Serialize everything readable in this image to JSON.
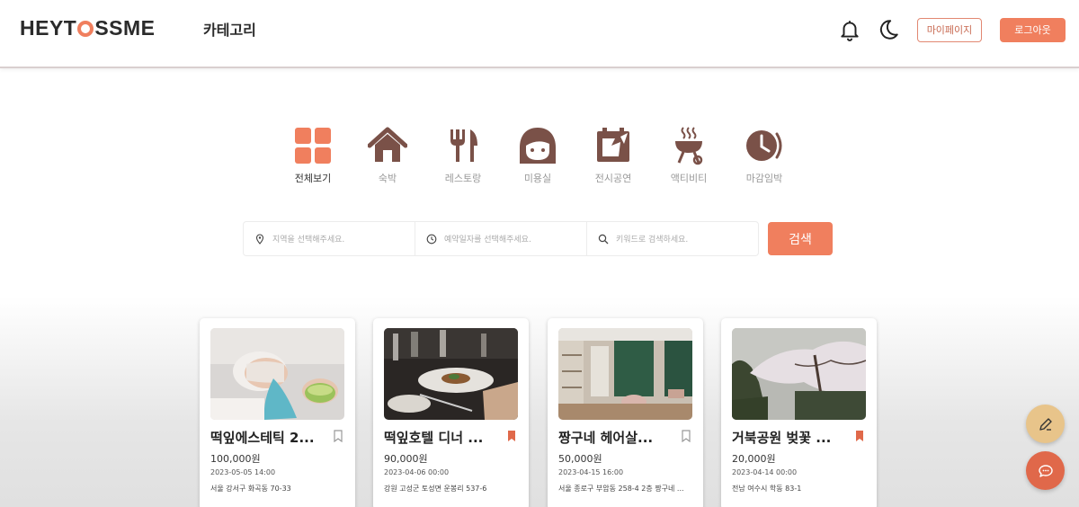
{
  "header": {
    "logo_left": "HEYT",
    "logo_right": "SSME",
    "category_label": "카테고리",
    "mypage_label": "마이페이지",
    "logout_label": "로그아웃"
  },
  "categories": [
    {
      "label": "전체보기",
      "icon": "grid-icon",
      "active": true
    },
    {
      "label": "숙박",
      "icon": "house-icon",
      "active": false
    },
    {
      "label": "레스토랑",
      "icon": "fork-knife-icon",
      "active": false
    },
    {
      "label": "미용실",
      "icon": "face-icon",
      "active": false
    },
    {
      "label": "전시공연",
      "icon": "ticket-icon",
      "active": false
    },
    {
      "label": "액티비티",
      "icon": "grill-icon",
      "active": false
    },
    {
      "label": "마감임박",
      "icon": "clock-icon",
      "active": false
    }
  ],
  "search": {
    "region_placeholder": "지역을 선택해주세요.",
    "date_placeholder": "예약일자를 선택해주세요.",
    "keyword_placeholder": "키워드로 검색하세요.",
    "button_label": "검색"
  },
  "cards": [
    {
      "title": "떡잎에스테틱 2...",
      "price": "100,000원",
      "date": "2023-05-05 14:00",
      "address": "서울 강서구 화곡동 70-33",
      "bookmarked": false
    },
    {
      "title": "떡잎호텔 디너 ...",
      "price": "90,000원",
      "date": "2023-04-06 00:00",
      "address": "강원 고성군 토성면 운봉리 537-6",
      "bookmarked": true
    },
    {
      "title": "짱구네 헤어살...",
      "price": "50,000원",
      "date": "2023-04-15 16:00",
      "address": "서울 종로구 부암동 258-4 2층 짱구네 ...",
      "bookmarked": false
    },
    {
      "title": "거북공원 벚꽃 ...",
      "price": "20,000원",
      "date": "2023-04-14 00:00",
      "address": "전남 여수시 학동 83-1",
      "bookmarked": true
    }
  ],
  "colors": {
    "accent": "#f07f5e",
    "icon_brown": "#7a5148",
    "fab_edit": "#e8c48a",
    "fab_chat": "#e0684a"
  }
}
